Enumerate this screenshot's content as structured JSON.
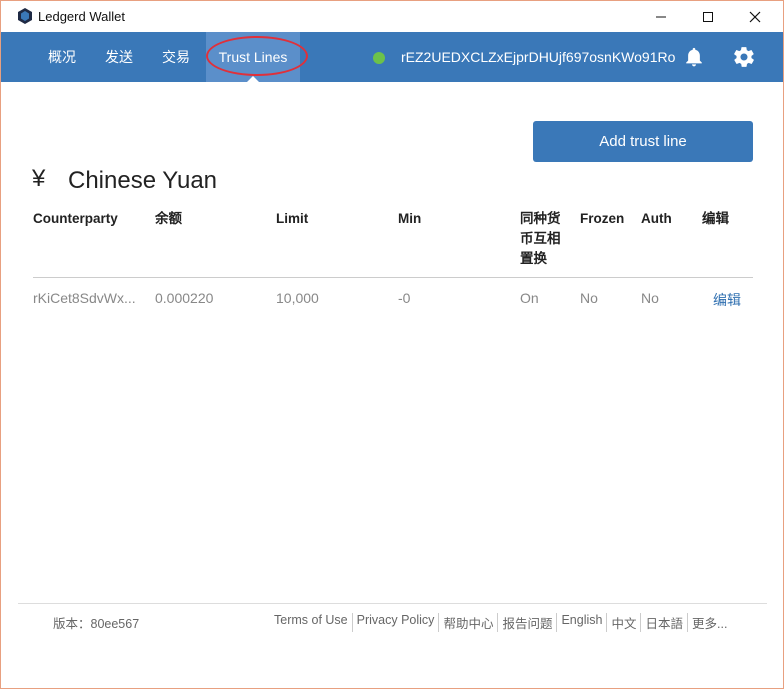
{
  "window": {
    "title": "Ledgerd Wallet",
    "minimize": "—",
    "maximize": "☐",
    "close": "✕"
  },
  "nav": {
    "tabs": [
      "概况",
      "发送",
      "交易",
      "Trust Lines"
    ],
    "active_tab": "Trust Lines",
    "address": "rEZ2UEDXCLZxEjprDHUjf697osnKWo91Ro",
    "status_color": "#6cc24a"
  },
  "main": {
    "add_button": "Add trust line",
    "currency_symbol": "¥",
    "currency_name": "Chinese Yuan",
    "columns": [
      "Counterparty",
      "余额",
      "Limit",
      "Min",
      "同种货币互相置换",
      "Frozen",
      "Auth",
      "编辑"
    ],
    "rows": [
      {
        "counterparty": "rKiCet8SdvWx...",
        "balance": "0.000220",
        "limit": "10,000",
        "min": "-0",
        "rippling": "On",
        "frozen": "No",
        "auth": "No",
        "edit": "编辑"
      }
    ]
  },
  "footer": {
    "version": "版本：80ee567",
    "links": [
      "Terms of Use",
      "Privacy Policy",
      "帮助中心",
      "报告问题",
      "English",
      "中文",
      "日本語",
      "更多..."
    ]
  },
  "colors": {
    "accent": "#3a78b8",
    "active_tab": "#5b8fca",
    "highlight": "#e0303a",
    "link": "#2f6fb0"
  }
}
